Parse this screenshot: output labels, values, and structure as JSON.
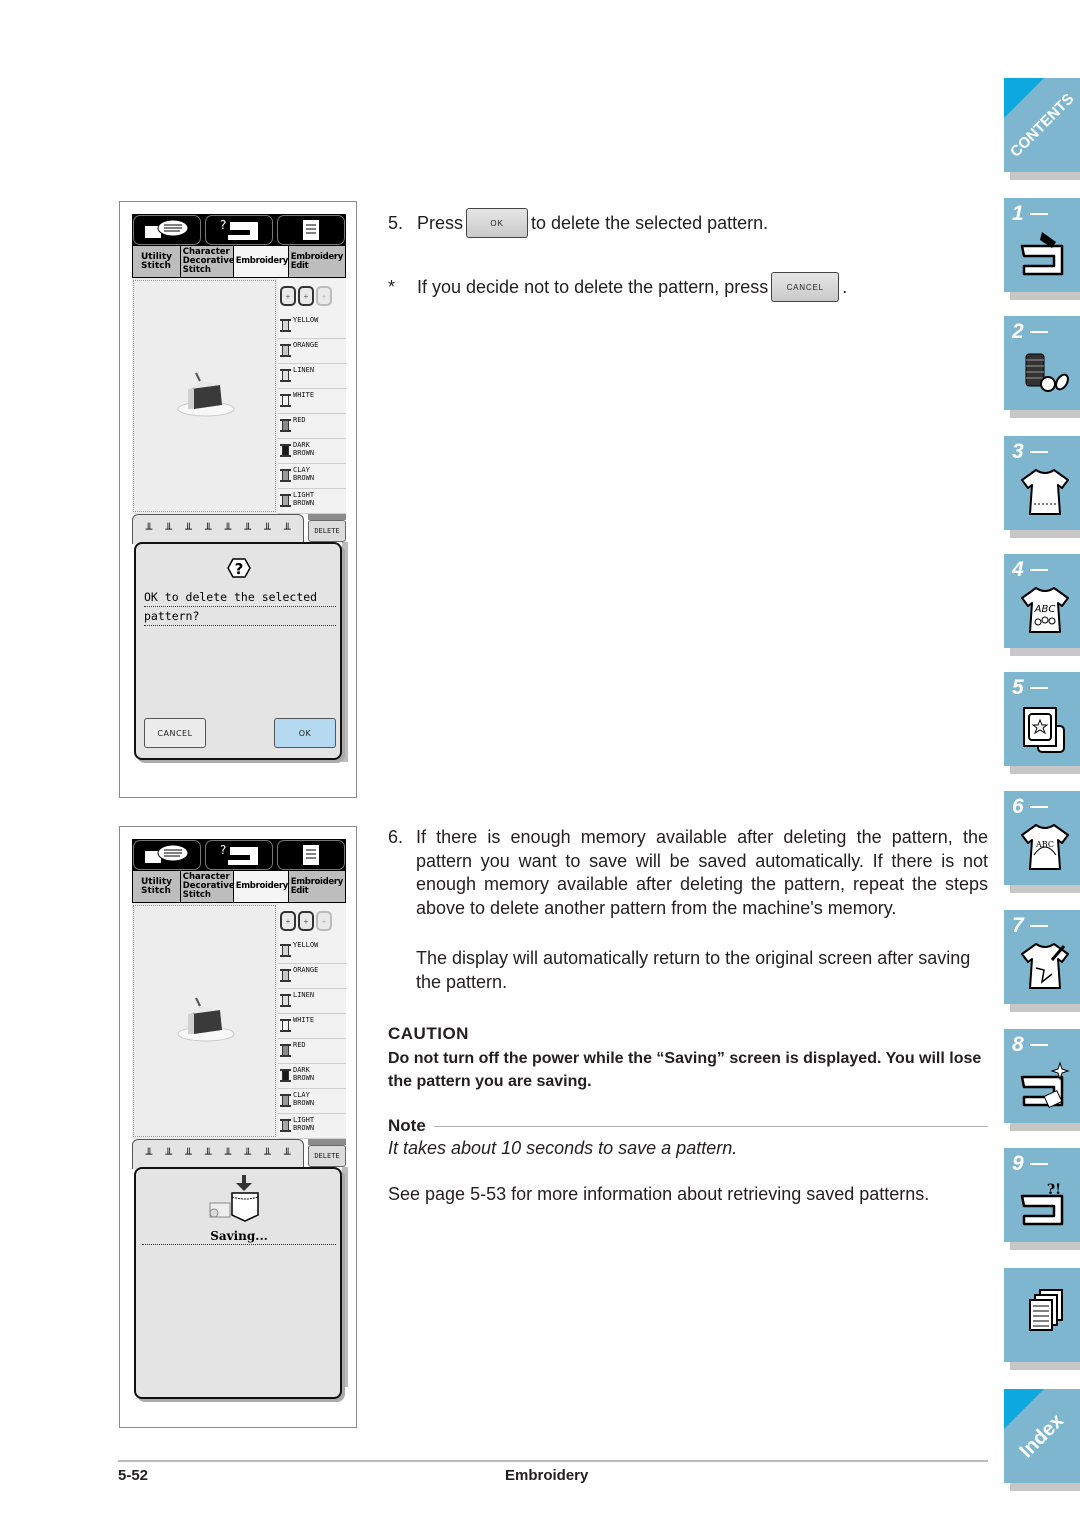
{
  "lcd": {
    "icon_buttons": [
      "sewing-book-icon",
      "help-machine-icon",
      "settings-list-icon"
    ],
    "tabs": [
      {
        "label": "Utility\nStitch"
      },
      {
        "label": "Character\nDecorative\nStitch"
      },
      {
        "label": "Embroidery",
        "selected": true
      },
      {
        "label": "Embroidery\nEdit"
      }
    ],
    "threads": [
      {
        "name": "YELLOW",
        "color": "#d6d6d6"
      },
      {
        "name": "ORANGE",
        "color": "#c8c8c8"
      },
      {
        "name": "LINEN",
        "color": "#dedede"
      },
      {
        "name": "WHITE",
        "color": "#f4f4f4"
      },
      {
        "name": "RED",
        "color": "#8a8a8a"
      },
      {
        "name": "DARK\nBROWN",
        "color": "#1a1a1a"
      },
      {
        "name": "CLAY\nBROWN",
        "color": "#9a9a9a"
      },
      {
        "name": "LIGHT\nBROWN",
        "color": "#a8a8a8"
      }
    ],
    "delete_label": "DELETE",
    "confirm_dialog": {
      "line1": "OK to delete the selected",
      "line2": "pattern?",
      "cancel_label": "CANCEL",
      "ok_label": "OK"
    },
    "saving_dialog": {
      "message": "Saving..."
    }
  },
  "steps": {
    "step5": {
      "number": "5.",
      "before": "Press",
      "button": "OK",
      "after": "to delete the selected pattern."
    },
    "star_note": {
      "marker": "*",
      "text": "If you decide not to delete the pattern, press",
      "button": "CANCEL",
      "after": "."
    },
    "step6": {
      "number": "6.",
      "text": "If there is enough memory available after deleting the pattern, the pattern you want to save will be saved automatically. If there is not enough memory available after deleting the pattern, repeat the steps above to delete another pattern from the machine's memory.",
      "text2": "The display will automatically return to the original screen after saving the pattern."
    }
  },
  "caution": {
    "heading": "CAUTION",
    "text": "Do not turn off the power while the “Saving” screen is displayed. You will lose the pattern you are saving."
  },
  "note": {
    "heading": "Note",
    "text": "It takes about 10 seconds to save a pattern."
  },
  "see_also": "See page 5-53 for more information about retrieving saved patterns.",
  "footer": {
    "page": "5-52",
    "section": "Embroidery"
  },
  "side_tabs": {
    "contents": "CONTENTS",
    "chapters": [
      "1",
      "2",
      "3",
      "4",
      "5",
      "6",
      "7",
      "8",
      "9"
    ],
    "index": "Index",
    "accent": "#7fb6cf",
    "corner_color": "#0ea8e0"
  }
}
